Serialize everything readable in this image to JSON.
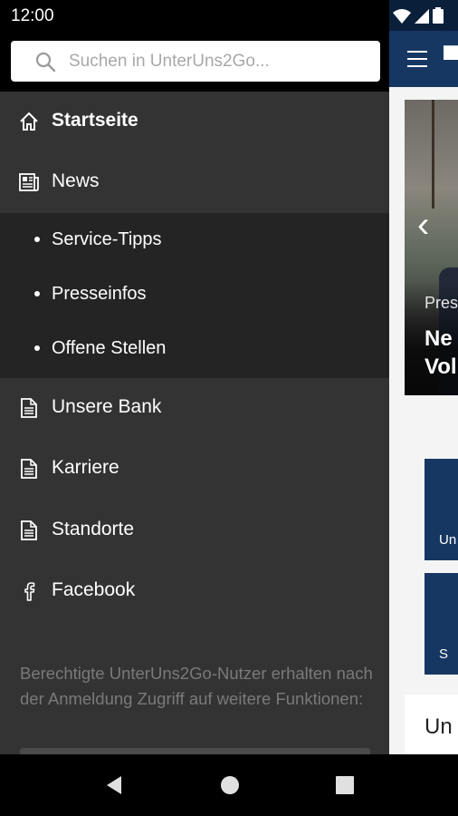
{
  "status_bar": {
    "time": "12:00",
    "icons": [
      "wifi-icon",
      "signal-icon",
      "battery-icon"
    ]
  },
  "search": {
    "placeholder": "Suchen in UnterUns2Go..."
  },
  "nav": {
    "items": [
      {
        "label": "Startseite",
        "icon": "home-icon",
        "active": true
      },
      {
        "label": "News",
        "icon": "newspaper-icon",
        "active": false
      },
      {
        "label": "Unsere Bank",
        "icon": "document-icon",
        "active": false
      },
      {
        "label": "Karriere",
        "icon": "document-icon",
        "active": false
      },
      {
        "label": "Standorte",
        "icon": "document-icon",
        "active": false
      },
      {
        "label": "Facebook",
        "icon": "facebook-icon",
        "active": false
      }
    ],
    "sub_items": [
      {
        "label": "Service-Tipps"
      },
      {
        "label": "Presseinfos"
      },
      {
        "label": "Offene Stellen"
      }
    ]
  },
  "info_text": "Berechtigte UnterUns2Go-Nutzer erhalten nach der Anmeldung Zugriff auf weitere Funktionen:",
  "background_app": {
    "hero_category": "Pres",
    "hero_headline_line1": "Ne",
    "hero_headline_line2": "Vol",
    "tile1_label": "Un",
    "tile2_label": "S",
    "section_title": "Un"
  },
  "colors": {
    "drawer_bg": "#333333",
    "submenu_bg": "#242424",
    "app_brand": "#163762",
    "info_text": "#7a7a7a"
  }
}
